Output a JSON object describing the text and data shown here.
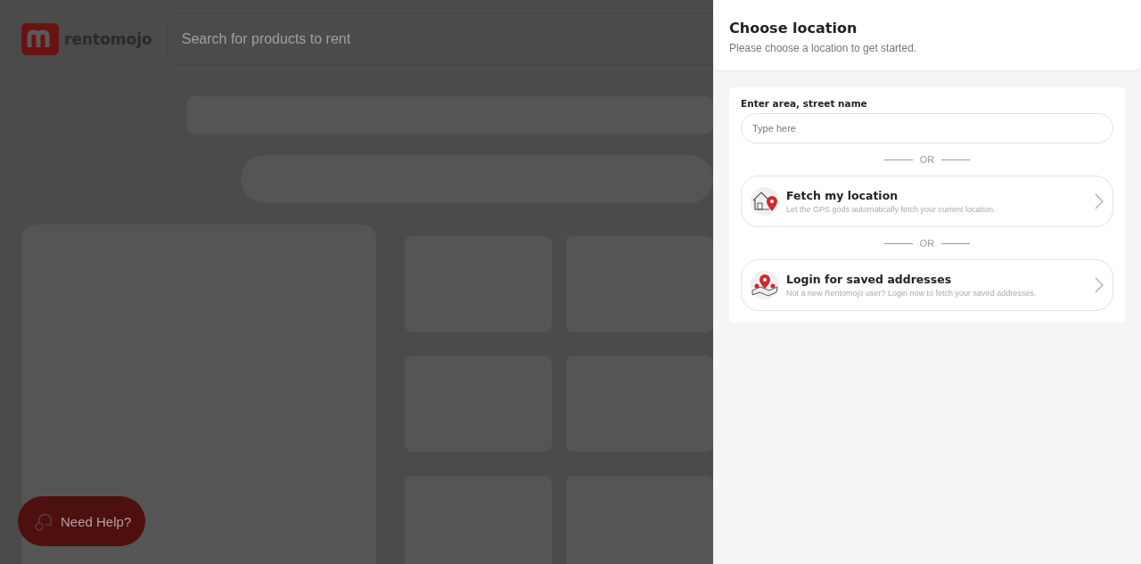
{
  "header": {
    "logo_text": "rentomojo",
    "search": {
      "placeholder": "Search for products to rent"
    }
  },
  "help_button": {
    "label": "Need Help?"
  },
  "drawer": {
    "title": "Choose location",
    "subtitle": "Please choose a location to get started.",
    "field": {
      "label": "Enter area, street name",
      "placeholder": "Type here"
    },
    "options": [
      {
        "kind": "gps",
        "title": "Fetch my location",
        "description": "Let the GPS gods automatically fetch your current location."
      },
      {
        "kind": "login",
        "title": "Login for saved addresses",
        "description": "Not a new Rentomojo user? Login now to fetch your saved addresses."
      }
    ],
    "separators": [
      "OR",
      "OR"
    ]
  }
}
